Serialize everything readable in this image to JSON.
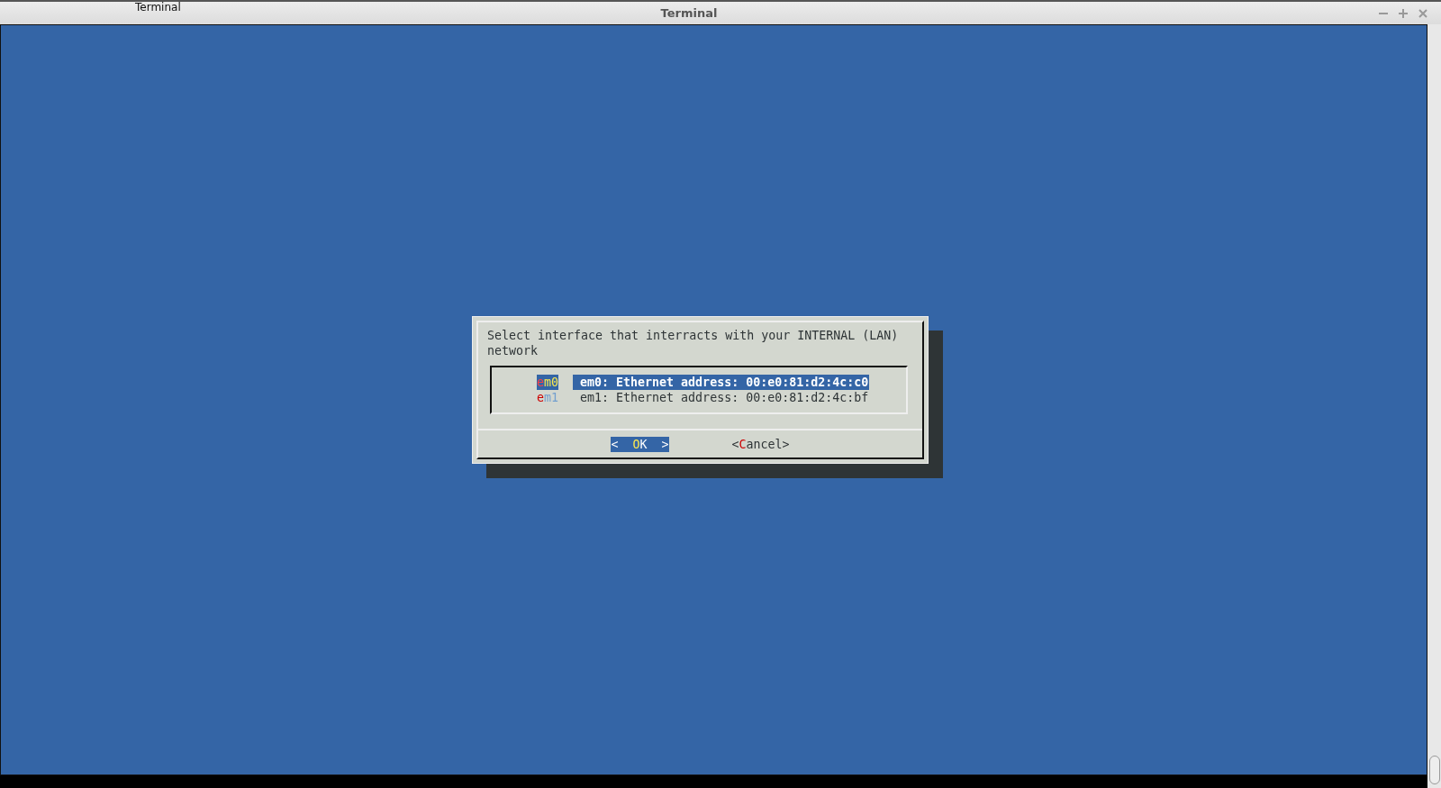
{
  "window": {
    "title": "Terminal",
    "tab_title": "Terminal"
  },
  "dialog": {
    "prompt": "Select interface that interracts with your INTERNAL (LAN) network",
    "items": [
      {
        "tag": "em0",
        "description": "em0: Ethernet address: 00:e0:81:d2:4c:c0",
        "selected": true
      },
      {
        "tag": "em1",
        "description": "em1: Ethernet address: 00:e0:81:d2:4c:bf",
        "selected": false
      }
    ],
    "buttons": [
      {
        "left": "<",
        "label": "OK",
        "right": ">",
        "selected": true
      },
      {
        "left": "<",
        "label": "Cancel",
        "right": ">",
        "selected": false
      }
    ]
  }
}
